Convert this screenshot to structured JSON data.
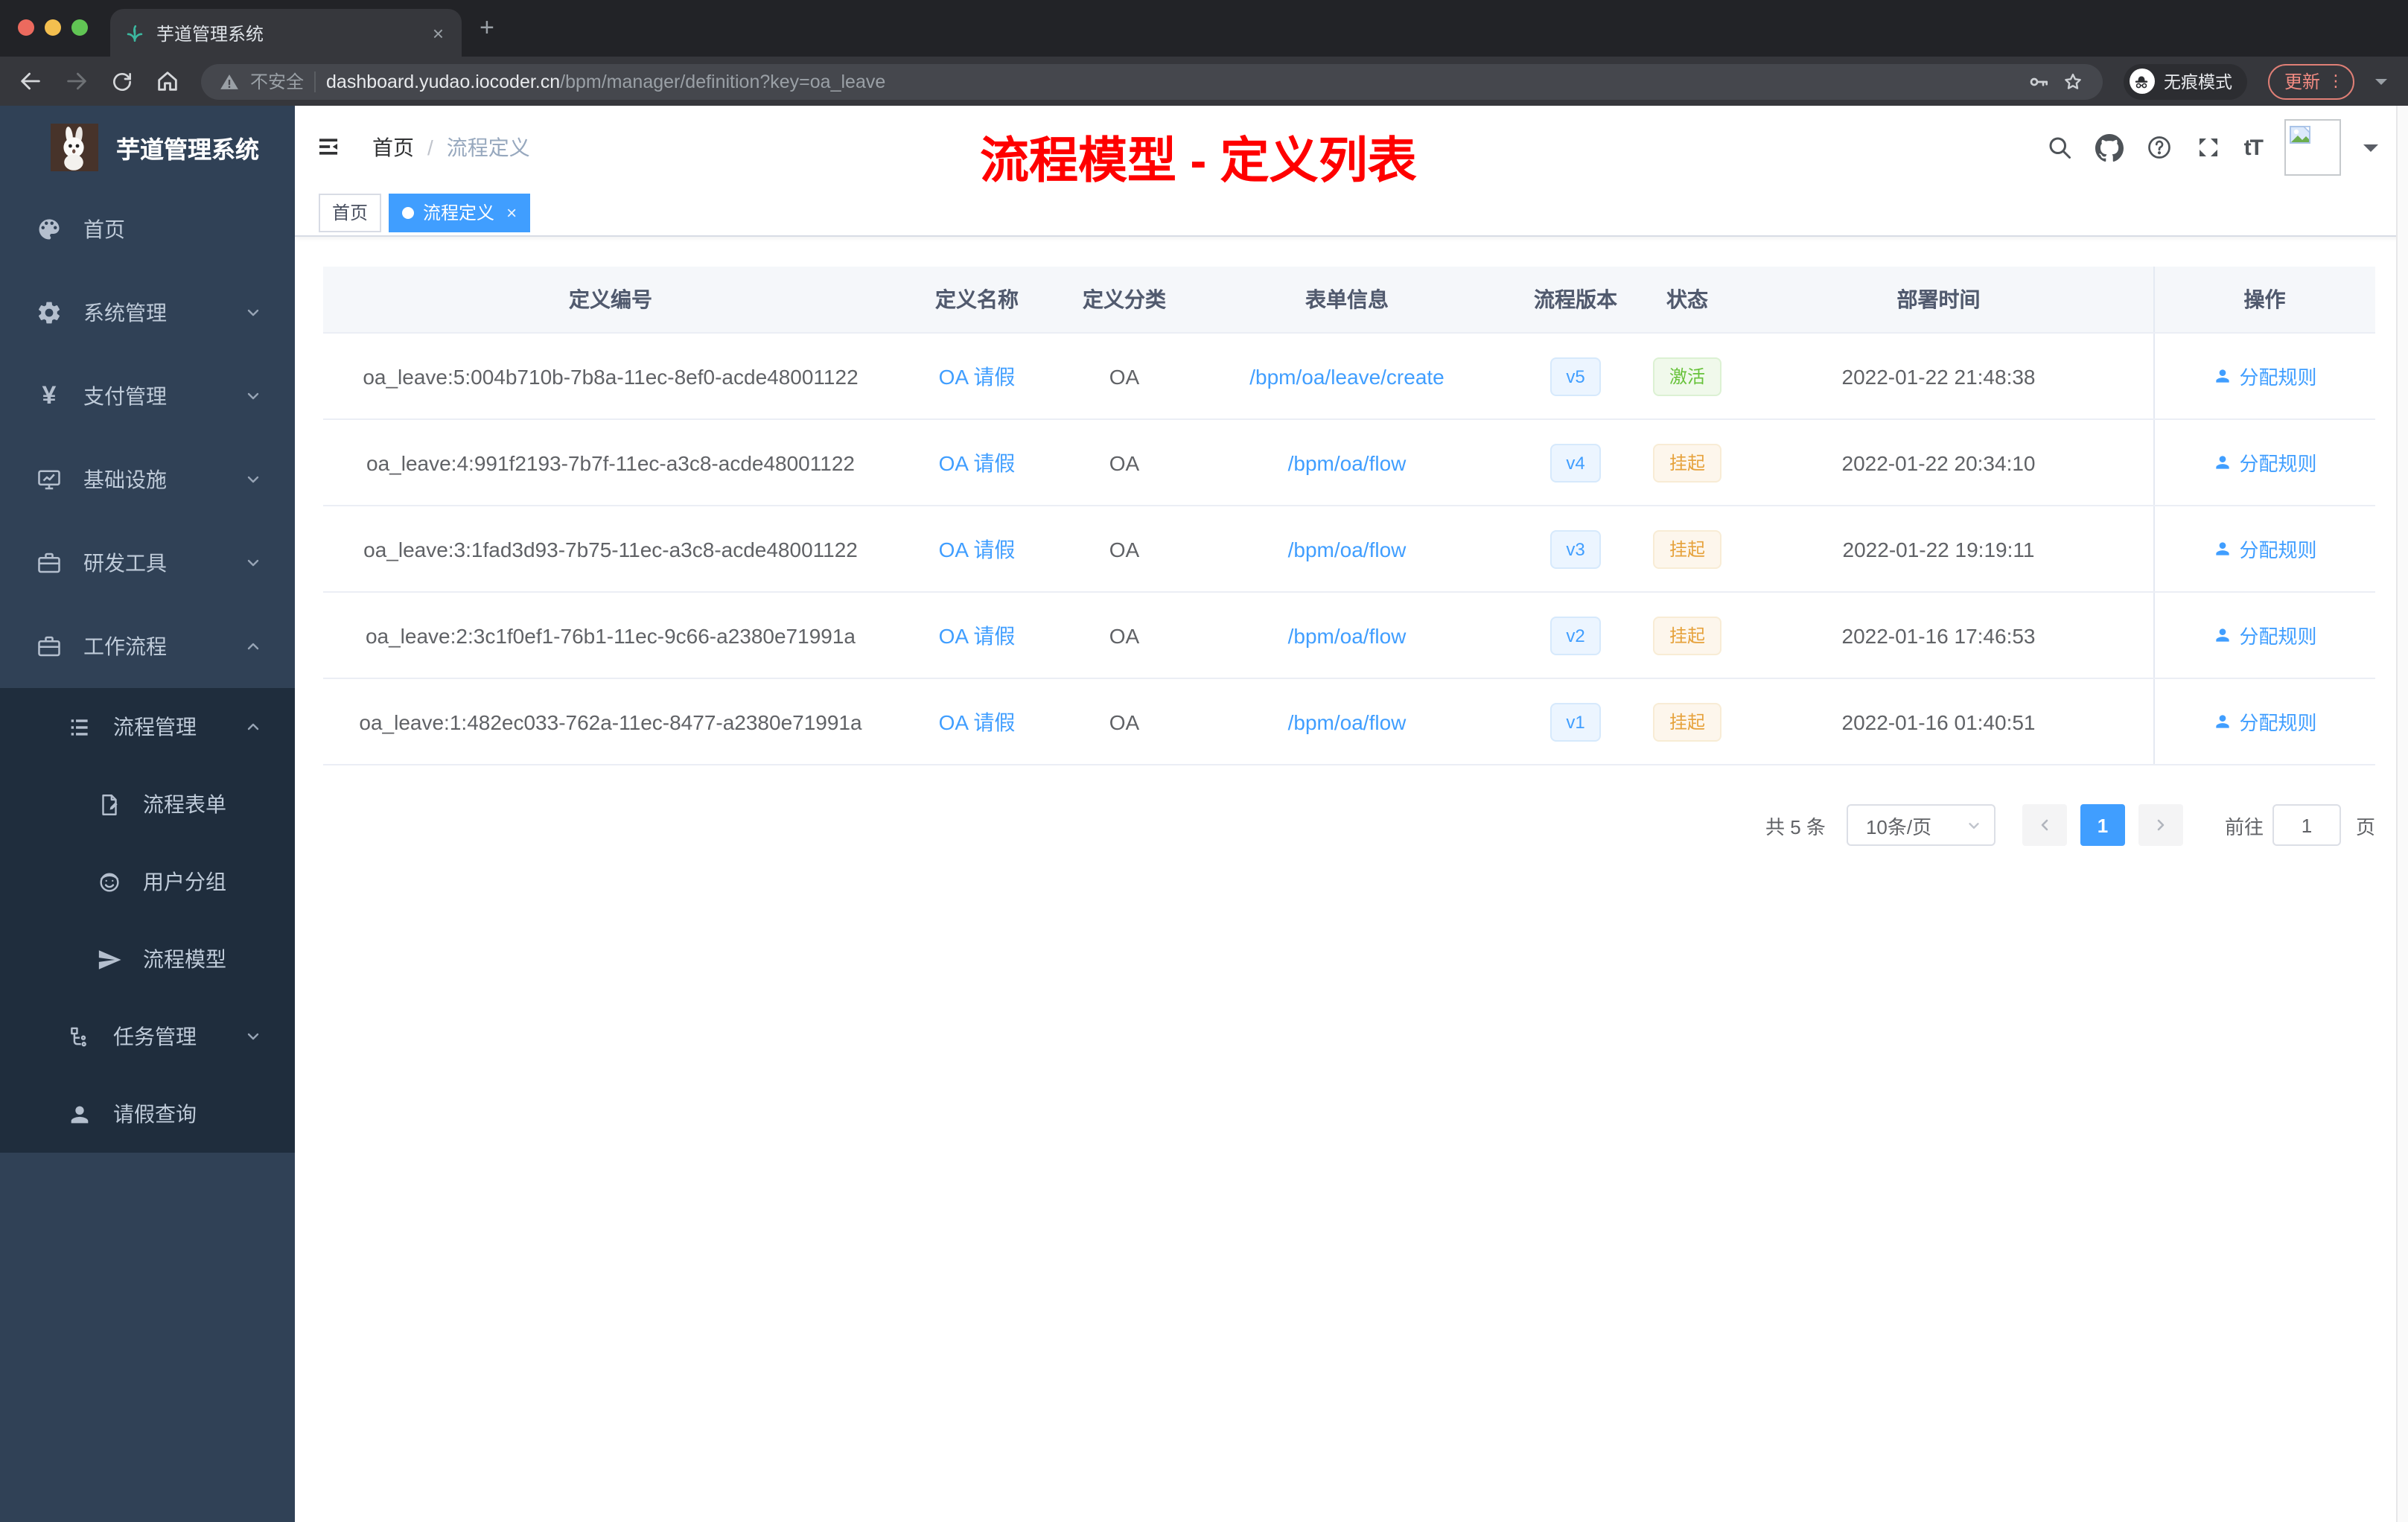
{
  "browser": {
    "tab_title": "芋道管理系统",
    "new_tab": "+",
    "security_label": "不安全",
    "url_host": "dashboard.yudao.iocoder.cn",
    "url_path": "/bpm/manager/definition?key=oa_leave",
    "incognito_label": "无痕模式",
    "update_label": "更新"
  },
  "sidebar": {
    "logo_title": "芋道管理系统",
    "menu": [
      {
        "label": "首页"
      },
      {
        "label": "系统管理"
      },
      {
        "label": "支付管理"
      },
      {
        "label": "基础设施"
      },
      {
        "label": "研发工具"
      },
      {
        "label": "工作流程"
      },
      {
        "label": "流程管理"
      },
      {
        "label": "流程表单"
      },
      {
        "label": "用户分组"
      },
      {
        "label": "流程模型"
      },
      {
        "label": "任务管理"
      },
      {
        "label": "请假查询"
      }
    ]
  },
  "header": {
    "breadcrumb_home": "首页",
    "breadcrumb_separator": "/",
    "breadcrumb_current": "流程定义",
    "annotation": "流程模型 - 定义列表",
    "annotation_color": "#ff0000"
  },
  "tags": {
    "home": "首页",
    "active": "流程定义",
    "close": "×"
  },
  "table": {
    "columns": [
      "定义编号",
      "定义名称",
      "定义分类",
      "表单信息",
      "流程版本",
      "状态",
      "部署时间",
      "操作"
    ],
    "action_label": "分配规则",
    "status_styles": {
      "激活": "green",
      "挂起": "orange"
    },
    "rows": [
      {
        "id": "oa_leave:5:004b710b-7b8a-11ec-8ef0-acde48001122",
        "name": "OA 请假",
        "category": "OA",
        "form": "/bpm/oa/leave/create",
        "version": "v5",
        "status": "激活",
        "time": "2022-01-22 21:48:38"
      },
      {
        "id": "oa_leave:4:991f2193-7b7f-11ec-a3c8-acde48001122",
        "name": "OA 请假",
        "category": "OA",
        "form": "/bpm/oa/flow",
        "version": "v4",
        "status": "挂起",
        "time": "2022-01-22 20:34:10"
      },
      {
        "id": "oa_leave:3:1fad3d93-7b75-11ec-a3c8-acde48001122",
        "name": "OA 请假",
        "category": "OA",
        "form": "/bpm/oa/flow",
        "version": "v3",
        "status": "挂起",
        "time": "2022-01-22 19:19:11"
      },
      {
        "id": "oa_leave:2:3c1f0ef1-76b1-11ec-9c66-a2380e71991a",
        "name": "OA 请假",
        "category": "OA",
        "form": "/bpm/oa/flow",
        "version": "v2",
        "status": "挂起",
        "time": "2022-01-16 17:46:53"
      },
      {
        "id": "oa_leave:1:482ec033-762a-11ec-8477-a2380e71991a",
        "name": "OA 请假",
        "category": "OA",
        "form": "/bpm/oa/flow",
        "version": "v1",
        "status": "挂起",
        "time": "2022-01-16 01:40:51"
      }
    ]
  },
  "pagination": {
    "total_label": "共 5 条",
    "page_size": "10条/页",
    "current_page": "1",
    "goto_label": "前往",
    "goto_value": "1",
    "page_label": "页"
  },
  "colors": {
    "accent": "#409eff",
    "status_active": "#67c23a",
    "status_suspended": "#e6a23c",
    "sidebar_bg": "#304156",
    "sidebar_submenu_bg": "#1f2d3d"
  }
}
